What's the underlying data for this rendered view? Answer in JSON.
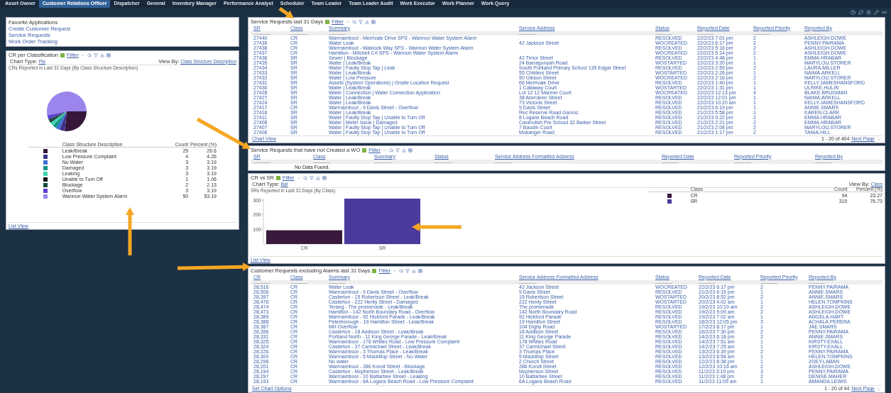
{
  "nav_tabs": [
    {
      "label": "Asset Owner",
      "selected": false
    },
    {
      "label": "Customer Relations Officer",
      "selected": true
    },
    {
      "label": "Dispatcher",
      "selected": false
    },
    {
      "label": "General",
      "selected": false
    },
    {
      "label": "Inventory Manager",
      "selected": false
    },
    {
      "label": "Performance Analyst",
      "selected": false
    },
    {
      "label": "Scheduler",
      "selected": false
    },
    {
      "label": "Team Leader",
      "selected": false
    },
    {
      "label": "Team Leader Audit",
      "selected": false
    },
    {
      "label": "Work Executor",
      "selected": false
    },
    {
      "label": "Work Planner",
      "selected": false
    },
    {
      "label": "Work Query",
      "selected": false
    }
  ],
  "favorites": {
    "title": "Favorite Applications",
    "links": [
      "Create Customer Request",
      "Service Requests",
      "Work Order Tracking"
    ]
  },
  "cr_per_classification": {
    "title": "CR per Classification",
    "filter": "Filter",
    "chart_type_label": "Chart Type:",
    "chart_type": "Pie",
    "view_by_label": "View By:",
    "view_by": "Class Structure Description",
    "footer_link": "List View",
    "legend_columns": [
      "Class Structure Description",
      "Count",
      "Percent (%)"
    ],
    "legend": [
      {
        "count": "25",
        "percent": "26.6",
        "color": "#36173a"
      },
      {
        "count": "4",
        "percent": "4.26",
        "color": "#3d3289"
      },
      {
        "count": "3",
        "percent": "3.19",
        "color": "#3f6fd8"
      },
      {
        "count": "3",
        "percent": "3.19",
        "color": "#12948a"
      },
      {
        "count": "3",
        "percent": "3.19",
        "color": "#3ed3b0"
      },
      {
        "count": "1",
        "percent": "1.06",
        "color": "#101418"
      },
      {
        "count": "2",
        "percent": "2.13",
        "color": "#184a3e"
      },
      {
        "count": "3",
        "percent": "3.19",
        "color": "#5c3fd0"
      },
      {
        "count": "50",
        "percent": "53.19",
        "color": "#9b85ec"
      }
    ],
    "chart_data": {
      "type": "pie",
      "title": "CRs Reported in Last 31 Days (By Class Structure Description)",
      "categories": [
        "Leak/Break",
        "Low Pressure Complaint",
        "No Water",
        "Damaged",
        "Leaking",
        "Unable to Turn Off",
        "Blockage",
        "Overflow",
        "Wannon Water System Alarm"
      ],
      "values": [
        26.6,
        4.26,
        3.19,
        3.19,
        3.19,
        1.06,
        2.13,
        3.19,
        53.19
      ]
    }
  },
  "service_requests": {
    "title": "Service Requests last 31 Days",
    "filter": "Filter",
    "columns": [
      "SR",
      "Class",
      "Summary",
      "Service Address",
      "Status",
      "Reported Date",
      "Reported Priority",
      "Reported By"
    ],
    "rows": [
      {
        "id": "27440",
        "class": "CR",
        "summary": "Warrnambool - Merrivale Drive SPS - Wannon Water System Alarm",
        "status": "RESOLVED",
        "date": "22/2/23 7:01 pm",
        "priority": "2",
        "reported_by": "ASHLEIGH.DOWE"
      },
      {
        "id": "27439",
        "class": "CR",
        "summary": "Water Leak",
        "address": "42 Jackson Street",
        "status": "WOCREATED",
        "date": "22/2/23 6:17 pm",
        "priority": "2",
        "reported_by": "PENNY.PAIRAMA"
      },
      {
        "id": "27438",
        "class": "CR",
        "summary": "Warrnambool - Waldock Way SPS - Wannon Water System Alarm",
        "status": "RESOLVED",
        "date": "22/2/23 5:16 pm",
        "priority": "2",
        "reported_by": "ASHLEIGH.DOWE"
      },
      {
        "id": "27437",
        "class": "CR",
        "summary": "Hamilton - Mitchell Crt SPS - Wannon Water System Alarm",
        "status": "WOCREATED",
        "date": "22/2/23 5:14 pm",
        "priority": "2",
        "reported_by": "ASHLEIGH.DOWE"
      },
      {
        "id": "27436",
        "class": "SR",
        "summary": "Sewer | Blockage",
        "address": "42 Timor Street",
        "status": "RESOLVED",
        "date": "22/2/23 4:48 pm",
        "priority": "1",
        "reported_by": "EMMA.HRABAR"
      },
      {
        "id": "27435",
        "class": "SR",
        "summary": "Water | Leak/Break",
        "address": "24 Barragunyah Road",
        "status": "WOSTARTED",
        "date": "22/2/23 3:20 pm",
        "priority": "1",
        "reported_by": "MARYLOU.STORER"
      },
      {
        "id": "27434",
        "class": "SR",
        "summary": "Water | Faulty Stop Tap | Leak",
        "address": "South Portland Primary School 135 Edgar Street",
        "status": "RESOLVED",
        "date": "22/2/23 2:59 pm",
        "priority": "2",
        "reported_by": "LAURA.MILLER"
      },
      {
        "id": "27433",
        "class": "SR",
        "summary": "Water | Leak/Break",
        "address": "55 Childers Street",
        "status": "WOSTARTED",
        "date": "22/2/23 2:26 pm",
        "priority": "1",
        "reported_by": "NAIMA.ARKELL"
      },
      {
        "id": "27432",
        "class": "SR",
        "summary": "Water | Low Pressure",
        "address": "50 Gibson Street",
        "status": "WOCREATED",
        "date": "22/2/23 2:16 pm",
        "priority": "2",
        "reported_by": "MARYLOU.STORER"
      },
      {
        "id": "27431",
        "class": "SR",
        "summary": "Assets (System Operations) | Onsite Location Request",
        "address": "66 Merrivale Drive",
        "status": "RESOLVED",
        "date": "22/2/23 1:40 pm",
        "priority": "1",
        "reported_by": "KELLY.JAMESHANSFORD"
      },
      {
        "id": "27430",
        "class": "SR",
        "summary": "Water | Leak/Break",
        "address": "1 Callaway Court",
        "status": "WOSTARTED",
        "date": "22/2/23 1:31 pm",
        "priority": "1",
        "reported_by": "ULRIKE.HULIN"
      },
      {
        "id": "27428",
        "class": "SR",
        "summary": "Water | Connection | Water Connection Application",
        "address": "Lot 12 12 Mariner Court",
        "status": "WOCREATED",
        "date": "22/2/23 12:13 pm",
        "priority": "4",
        "reported_by": "BLAKE.BRUGMAN"
      },
      {
        "id": "27427",
        "class": "SR",
        "summary": "Water | Leak/Break",
        "address": "38 Aberdeen Street",
        "status": "RESOLVED",
        "date": "22/2/23 12:01 pm",
        "priority": "1",
        "reported_by": "NAIMA.ARKELL"
      },
      {
        "id": "27424",
        "class": "SR",
        "summary": "Water | Leak/Break",
        "address": "73 Victoria Street",
        "status": "RESOLVED",
        "date": "22/2/23 10:20 am",
        "priority": "1",
        "reported_by": "KELLY.JAMESHANSFORD"
      },
      {
        "id": "27417",
        "class": "CR",
        "summary": "Warrnambool - 9 Davis Street - Overflow",
        "address": "9 Davis Street",
        "status": "RESOLVED",
        "date": "21/2/23 6:19 pm",
        "priority": "1",
        "reported_by": "ANNIE.SMARS"
      },
      {
        "id": "27416",
        "class": "SR",
        "summary": "Water | Leak/Break",
        "address": "Rec Reserve Road Garvoc",
        "status": "RESOLVED",
        "date": "21/2/23 5:58 pm",
        "priority": "1",
        "reported_by": "KAREN.CLARK"
      },
      {
        "id": "27411",
        "class": "SR",
        "summary": "Water | Faulty Stop Tap | Unable to Turn Off",
        "address": "8 Logans Beach Road",
        "status": "RESOLVED",
        "date": "21/2/23 5:22 pm",
        "priority": "2",
        "reported_by": "EMMA.HRABAR"
      },
      {
        "id": "27408",
        "class": "SR",
        "summary": "Water | Meter Issue | Damaged",
        "address": "Cavendish Pre School 32 Barker Street",
        "status": "RESOLVED",
        "date": "21/2/23 2:21 pm",
        "priority": "2",
        "reported_by": "EMMA.HRABAR"
      },
      {
        "id": "27407",
        "class": "SR",
        "summary": "Water | Faulty Stop Tap | Unable to Turn Off",
        "address": "7 Baudin Court",
        "status": "RESOLVED",
        "date": "21/2/23 2:08 pm",
        "priority": "2",
        "reported_by": "MARYLOU.STORER"
      },
      {
        "id": "27406",
        "class": "SR",
        "summary": "Water | Faulty Stop Tap | Unable to Turn Off",
        "address": "Mokanger Road",
        "status": "RESOLVED",
        "date": "21/2/23 1:17 pm",
        "priority": "2",
        "reported_by": "TANIA.HILL"
      }
    ],
    "footer_link": "Chart View",
    "pager": "1 - 20 of 404",
    "next": "Next Page"
  },
  "no_wo_requests": {
    "title": "Service Requests that have not Created a WO",
    "filter": "Filter",
    "columns": [
      "SR",
      "Class",
      "Summary",
      "Status",
      "Service Address Formatted Address",
      "Reported Date",
      "Reported Priority",
      "Reported By"
    ],
    "empty": "No Data Found."
  },
  "cr_vs_sr": {
    "title": "CR vs SR",
    "filter": "Filter",
    "chart_type_label": "Chart Type:",
    "chart_type": "Bar",
    "view_by_label": "View By:",
    "view_by": "Class",
    "footer_link": "List View",
    "legend_columns": [
      "Class",
      "Count",
      "Percent (%)"
    ],
    "legend": [
      {
        "label": "CR",
        "count": "94",
        "percent": "23.27",
        "color": "#3a1a3c"
      },
      {
        "label": "SR",
        "count": "310",
        "percent": "76.73",
        "color": "#4b3a9c"
      }
    ],
    "chart_data": {
      "type": "bar",
      "title": "SRs Reported in Last 31 Days (By Class)",
      "categories": [
        "CR",
        "SR"
      ],
      "values": [
        94,
        310
      ],
      "ylim": [
        0,
        310
      ],
      "yticks": [
        100,
        200,
        300
      ]
    }
  },
  "customer_requests": {
    "title": "Customer Requests excluding Alarms last 31 Days",
    "filter": "Filter",
    "columns": [
      "CR",
      "Class",
      "Summary",
      "Service Address Formatted Address",
      "Status",
      "Reported Date",
      "Reported Priority",
      "Reported By"
    ],
    "rows": [
      {
        "id": "28,516",
        "class": "CR",
        "summary": "Water Leak",
        "address": "42 Jackson Street",
        "status": "WOCREATED",
        "date": "22/2/23 6:17 pm",
        "priority": "2",
        "reported_by": "PENNY.PAIRAMA"
      },
      {
        "id": "28,506",
        "class": "CR",
        "summary": "Warrnambool - 9 Davis Street - Overflow",
        "address": "9 Davis Street",
        "status": "RESOLVED",
        "date": "21/2/23 6:19 pm",
        "priority": "1",
        "reported_by": "ANNIE.SMARS"
      },
      {
        "id": "28,397",
        "class": "CR",
        "summary": "Casterton - 15 Robertson Street - Leak/Break",
        "address": "15 Robertson Street",
        "status": "WOSTARTED",
        "date": "20/2/23 8:52 pm",
        "priority": "2",
        "reported_by": "ANNIE.SMARS"
      },
      {
        "id": "28,476",
        "class": "CR",
        "summary": "Casterton - 222 Henty Street - Damaged",
        "address": "222 Henty Street",
        "status": "WOSTARTED",
        "date": "20/2/23 4:02 am",
        "priority": "1",
        "reported_by": "HELEN.TOMPKINS"
      },
      {
        "id": "28,474",
        "class": "CR",
        "summary": "Terang - The promenade - Leak/Break",
        "address": "The promenade",
        "status": "RESOLVED",
        "date": "19/2/23 10:19 am",
        "priority": "2",
        "reported_by": "ASHLEIGH.DOWE"
      },
      {
        "id": "28,473",
        "class": "CR",
        "summary": "Hamilton - 142 North Boundary Road - Overflow",
        "address": "142 North Boundary Road",
        "status": "RESOLVED",
        "date": "19/2/23 9:09 am",
        "priority": "2",
        "reported_by": "ASHLEIGH.DOWE"
      },
      {
        "id": "28,389",
        "class": "CR",
        "summary": "Warrnambool - 92 Hickford Parade - Leak/Break",
        "address": "92 Hickford Parade",
        "status": "RESOLVED",
        "date": "19/2/23 7:02 am",
        "priority": "1",
        "reported_by": "ANGELA.HART"
      },
      {
        "id": "28,388",
        "class": "CR",
        "summary": "Peterborough - 19 Hamilton Street - Leak/Break",
        "address": "19 Hamilton Street",
        "status": "RESOLVED",
        "date": "18/2/23 12:05 pm",
        "priority": "3",
        "reported_by": "ACHALA.PERERA"
      },
      {
        "id": "28,387",
        "class": "CR",
        "summary": "MH Overflow",
        "address": "104 Digby Road",
        "status": "WOSTARTED",
        "date": "17/2/23 8:17 pm",
        "priority": "1",
        "reported_by": "JAE.SMARS"
      },
      {
        "id": "28,356",
        "class": "CR",
        "summary": "Casterton - 18 Addison Street - Leak/Break",
        "address": "18 Addison Street",
        "status": "RESOLVED",
        "date": "16/2/23 7:30 pm",
        "priority": "2",
        "reported_by": "PENNY.PAIRAMA"
      },
      {
        "id": "28,331",
        "class": "CR",
        "summary": "Portland North - 11 King George Parade - Leak/Break",
        "address": "11 King George Parade",
        "status": "RESOLVED",
        "date": "14/2/23 6:18 pm",
        "priority": "2",
        "reported_by": "ANNIE.SMARS"
      },
      {
        "id": "28,325",
        "class": "CR",
        "summary": "Warrnambool - 178 Whites Road - Low Pressure Complaint",
        "address": "178 Whites Road",
        "status": "RESOLVED",
        "date": "14/2/23 7:51 am",
        "priority": "1",
        "reported_by": "KIRSTY.EXALL"
      },
      {
        "id": "28,324",
        "class": "CR",
        "summary": "Casterton - 37 Carmichael Street - Leak/Break",
        "address": "37 Carmichael Street",
        "status": "RESOLVED",
        "date": "14/2/23 7:25 am",
        "priority": "1",
        "reported_by": "KIRSTY.EXALL"
      },
      {
        "id": "28,226",
        "class": "CR",
        "summary": "Warrnambool - 3 Thomas Place - Leak/Break",
        "address": "3 Thomas Place",
        "status": "RESOLVED",
        "date": "13/2/23 6:39 pm",
        "priority": "2",
        "reported_by": "PENNY.PAIRAMA"
      },
      {
        "id": "28,300",
        "class": "CR",
        "summary": "Warrnambool - 5 Mackillop Street - No Water",
        "address": "5 Mackillop Street",
        "status": "RESOLVED",
        "date": "13/2/23 6:54 am",
        "priority": "1",
        "reported_by": "HELEN.TOMPKINS"
      },
      {
        "id": "28,298",
        "class": "CR",
        "summary": "No water",
        "address": "2 Church Street",
        "status": "RESOLVED",
        "date": "12/2/23 8:38 pm",
        "priority": "1",
        "reported_by": "ZOEY.LABAN"
      },
      {
        "id": "28,201",
        "class": "CR",
        "summary": "Warrnambool - 286 Koroit Street - Blockage",
        "address": "286 Koroit Street",
        "status": "RESOLVED",
        "date": "12/2/23 10:16 am",
        "priority": "2",
        "reported_by": "ASHLEIGH.DOWE"
      },
      {
        "id": "28,194",
        "class": "CR",
        "summary": "Casterton - Mcpherson Street - Leak/Break",
        "address": "Mcpherson Street",
        "status": "RESOLVED",
        "date": "11/2/23 3:10 pm",
        "priority": "3",
        "reported_by": "PENNY.PAIRAMA"
      },
      {
        "id": "28,297",
        "class": "CR",
        "summary": "Warrnambool - 10 Battarbee Street - Leaking",
        "address": "10 Battarbee Street",
        "status": "RESOLVED",
        "date": "11/2/23 1:48 pm",
        "priority": "2",
        "reported_by": "DENISE.MAHER"
      },
      {
        "id": "28,193",
        "class": "CR",
        "summary": "Warrnambool - 6A Logans Beach Road - Low Pressure Complaint",
        "address": "6A Logans Beach Road",
        "status": "RESOLVED",
        "date": "11/2/23 11:09 am",
        "priority": "1",
        "reported_by": "AMANDA.LEWIS"
      }
    ],
    "footer_link": "Set Chart Options",
    "pager": "1 - 20 of 44",
    "next": "Next Page"
  }
}
